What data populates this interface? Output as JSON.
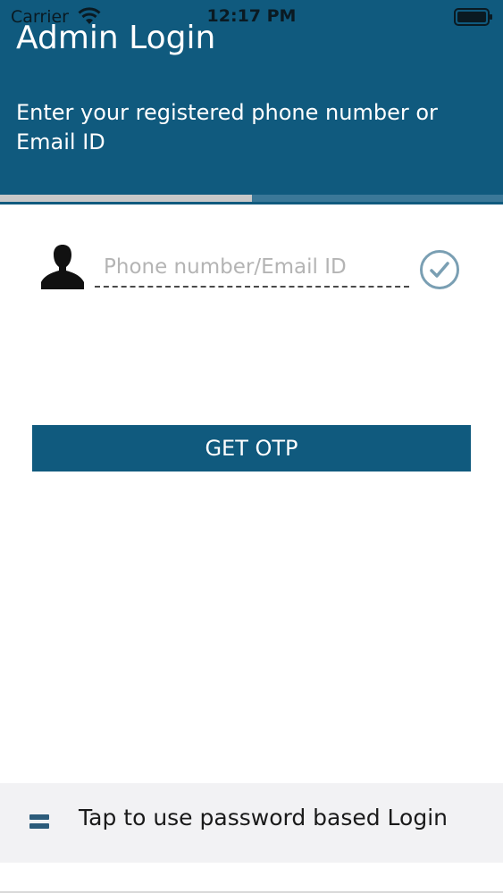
{
  "status_bar": {
    "carrier": "Carrier",
    "time": "12:17 PM",
    "wifi_icon": "wifi-icon",
    "battery_icon": "battery-full-icon"
  },
  "header": {
    "title": "Admin Login",
    "subtitle": "Enter your registered phone number or Email ID",
    "background_color": "#105a7e",
    "progress": 0.5
  },
  "form": {
    "user_icon": "user-silhouette-icon",
    "input_value": "",
    "input_placeholder": "Phone number/Email ID",
    "status_icon": "check-circle-icon",
    "submit_label": "GET OTP"
  },
  "footer": {
    "menu_icon": "menu-icon",
    "label": "Tap to use password based Login"
  }
}
